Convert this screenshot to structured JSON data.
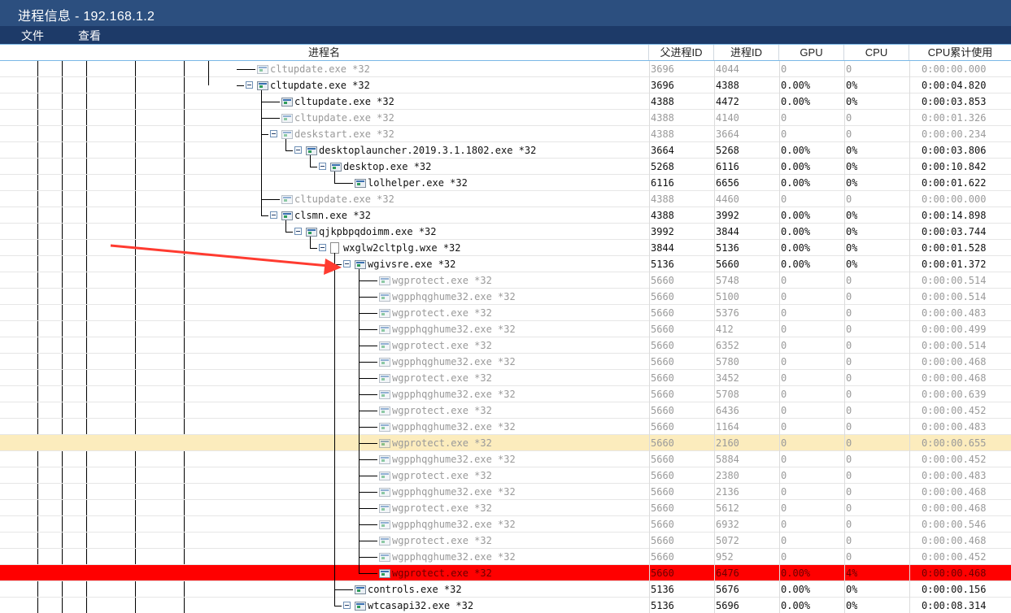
{
  "window": {
    "title": "进程信息 - 192.168.1.2"
  },
  "menu": [
    {
      "label": "文件"
    },
    {
      "label": "查看"
    }
  ],
  "columns": [
    {
      "key": "name",
      "label": "进程名"
    },
    {
      "key": "ppid",
      "label": "父进程ID"
    },
    {
      "key": "pid",
      "label": "进程ID"
    },
    {
      "key": "gpu",
      "label": "GPU"
    },
    {
      "key": "cpu",
      "label": "CPU"
    },
    {
      "key": "cputime",
      "label": "CPU累计使用"
    }
  ],
  "rows": [
    {
      "name": "cltupdate.exe *32",
      "ppid": "3696",
      "pid": "4044",
      "gpu": "0",
      "cpu": "0",
      "cputime": "0:00:00.000",
      "depth": 9,
      "expandable": false,
      "dim": true,
      "icon": "process-icon"
    },
    {
      "name": "cltupdate.exe *32",
      "ppid": "3696",
      "pid": "4388",
      "gpu": "0.00%",
      "cpu": "0%",
      "cputime": "0:00:04.820",
      "depth": 9,
      "expandable": true,
      "dim": false,
      "icon": "process-icon"
    },
    {
      "name": "cltupdate.exe *32",
      "ppid": "4388",
      "pid": "4472",
      "gpu": "0.00%",
      "cpu": "0%",
      "cputime": "0:00:03.853",
      "depth": 10,
      "expandable": false,
      "dim": false,
      "icon": "process-icon"
    },
    {
      "name": "cltupdate.exe *32",
      "ppid": "4388",
      "pid": "4140",
      "gpu": "0",
      "cpu": "0",
      "cputime": "0:00:01.326",
      "depth": 10,
      "expandable": false,
      "dim": true,
      "icon": "process-icon"
    },
    {
      "name": "deskstart.exe *32",
      "ppid": "4388",
      "pid": "3664",
      "gpu": "0",
      "cpu": "0",
      "cputime": "0:00:00.234",
      "depth": 10,
      "expandable": true,
      "dim": true,
      "icon": "process-icon"
    },
    {
      "name": "desktoplauncher.2019.3.1.1802.exe *32",
      "ppid": "3664",
      "pid": "5268",
      "gpu": "0.00%",
      "cpu": "0%",
      "cputime": "0:00:03.806",
      "depth": 11,
      "expandable": true,
      "dim": false,
      "icon": "process-icon"
    },
    {
      "name": "desktop.exe *32",
      "ppid": "5268",
      "pid": "6116",
      "gpu": "0.00%",
      "cpu": "0%",
      "cputime": "0:00:10.842",
      "depth": 12,
      "expandable": true,
      "dim": false,
      "icon": "process-icon"
    },
    {
      "name": "lolhelper.exe *32",
      "ppid": "6116",
      "pid": "6656",
      "gpu": "0.00%",
      "cpu": "0%",
      "cputime": "0:00:01.622",
      "depth": 13,
      "expandable": false,
      "dim": false,
      "icon": "process-icon"
    },
    {
      "name": "cltupdate.exe *32",
      "ppid": "4388",
      "pid": "4460",
      "gpu": "0",
      "cpu": "0",
      "cputime": "0:00:00.000",
      "depth": 10,
      "expandable": false,
      "dim": true,
      "icon": "process-icon"
    },
    {
      "name": "clsmn.exe *32",
      "ppid": "4388",
      "pid": "3992",
      "gpu": "0.00%",
      "cpu": "0%",
      "cputime": "0:00:14.898",
      "depth": 10,
      "expandable": true,
      "dim": false,
      "icon": "process-icon"
    },
    {
      "name": "qjkpbpqdoimm.exe *32",
      "ppid": "3992",
      "pid": "3844",
      "gpu": "0.00%",
      "cpu": "0%",
      "cputime": "0:00:03.744",
      "depth": 11,
      "expandable": true,
      "dim": false,
      "icon": "process-icon"
    },
    {
      "name": "wxglw2cltplg.wxe *32",
      "ppid": "3844",
      "pid": "5136",
      "gpu": "0.00%",
      "cpu": "0%",
      "cputime": "0:00:01.528",
      "depth": 12,
      "expandable": true,
      "dim": false,
      "icon": "document-icon"
    },
    {
      "name": "wgivsre.exe *32",
      "ppid": "5136",
      "pid": "5660",
      "gpu": "0.00%",
      "cpu": "0%",
      "cputime": "0:00:01.372",
      "depth": 13,
      "expandable": true,
      "dim": false,
      "icon": "process-icon"
    },
    {
      "name": "wgprotect.exe *32",
      "ppid": "5660",
      "pid": "5748",
      "gpu": "0",
      "cpu": "0",
      "cputime": "0:00:00.514",
      "depth": 14,
      "expandable": false,
      "dim": true,
      "icon": "process-icon"
    },
    {
      "name": "wgpphqghume32.exe *32",
      "ppid": "5660",
      "pid": "5100",
      "gpu": "0",
      "cpu": "0",
      "cputime": "0:00:00.514",
      "depth": 14,
      "expandable": false,
      "dim": true,
      "icon": "process-icon"
    },
    {
      "name": "wgprotect.exe *32",
      "ppid": "5660",
      "pid": "5376",
      "gpu": "0",
      "cpu": "0",
      "cputime": "0:00:00.483",
      "depth": 14,
      "expandable": false,
      "dim": true,
      "icon": "process-icon"
    },
    {
      "name": "wgpphqghume32.exe *32",
      "ppid": "5660",
      "pid": "412",
      "gpu": "0",
      "cpu": "0",
      "cputime": "0:00:00.499",
      "depth": 14,
      "expandable": false,
      "dim": true,
      "icon": "process-icon"
    },
    {
      "name": "wgprotect.exe *32",
      "ppid": "5660",
      "pid": "6352",
      "gpu": "0",
      "cpu": "0",
      "cputime": "0:00:00.514",
      "depth": 14,
      "expandable": false,
      "dim": true,
      "icon": "process-icon"
    },
    {
      "name": "wgpphqghume32.exe *32",
      "ppid": "5660",
      "pid": "5780",
      "gpu": "0",
      "cpu": "0",
      "cputime": "0:00:00.468",
      "depth": 14,
      "expandable": false,
      "dim": true,
      "icon": "process-icon"
    },
    {
      "name": "wgprotect.exe *32",
      "ppid": "5660",
      "pid": "3452",
      "gpu": "0",
      "cpu": "0",
      "cputime": "0:00:00.468",
      "depth": 14,
      "expandable": false,
      "dim": true,
      "icon": "process-icon"
    },
    {
      "name": "wgpphqghume32.exe *32",
      "ppid": "5660",
      "pid": "5708",
      "gpu": "0",
      "cpu": "0",
      "cputime": "0:00:00.639",
      "depth": 14,
      "expandable": false,
      "dim": true,
      "icon": "process-icon"
    },
    {
      "name": "wgprotect.exe *32",
      "ppid": "5660",
      "pid": "6436",
      "gpu": "0",
      "cpu": "0",
      "cputime": "0:00:00.452",
      "depth": 14,
      "expandable": false,
      "dim": true,
      "icon": "process-icon"
    },
    {
      "name": "wgpphqghume32.exe *32",
      "ppid": "5660",
      "pid": "1164",
      "gpu": "0",
      "cpu": "0",
      "cputime": "0:00:00.483",
      "depth": 14,
      "expandable": false,
      "dim": true,
      "icon": "process-icon"
    },
    {
      "name": "wgprotect.exe *32",
      "ppid": "5660",
      "pid": "2160",
      "gpu": "0",
      "cpu": "0",
      "cputime": "0:00:00.655",
      "depth": 14,
      "expandable": false,
      "dim": true,
      "icon": "process-icon",
      "highlight": "yellow"
    },
    {
      "name": "wgpphqghume32.exe *32",
      "ppid": "5660",
      "pid": "5884",
      "gpu": "0",
      "cpu": "0",
      "cputime": "0:00:00.452",
      "depth": 14,
      "expandable": false,
      "dim": true,
      "icon": "process-icon"
    },
    {
      "name": "wgprotect.exe *32",
      "ppid": "5660",
      "pid": "2380",
      "gpu": "0",
      "cpu": "0",
      "cputime": "0:00:00.483",
      "depth": 14,
      "expandable": false,
      "dim": true,
      "icon": "process-icon"
    },
    {
      "name": "wgpphqghume32.exe *32",
      "ppid": "5660",
      "pid": "2136",
      "gpu": "0",
      "cpu": "0",
      "cputime": "0:00:00.468",
      "depth": 14,
      "expandable": false,
      "dim": true,
      "icon": "process-icon"
    },
    {
      "name": "wgprotect.exe *32",
      "ppid": "5660",
      "pid": "5612",
      "gpu": "0",
      "cpu": "0",
      "cputime": "0:00:00.468",
      "depth": 14,
      "expandable": false,
      "dim": true,
      "icon": "process-icon"
    },
    {
      "name": "wgpphqghume32.exe *32",
      "ppid": "5660",
      "pid": "6932",
      "gpu": "0",
      "cpu": "0",
      "cputime": "0:00:00.546",
      "depth": 14,
      "expandable": false,
      "dim": true,
      "icon": "process-icon"
    },
    {
      "name": "wgprotect.exe *32",
      "ppid": "5660",
      "pid": "5072",
      "gpu": "0",
      "cpu": "0",
      "cputime": "0:00:00.468",
      "depth": 14,
      "expandable": false,
      "dim": true,
      "icon": "process-icon"
    },
    {
      "name": "wgpphqghume32.exe *32",
      "ppid": "5660",
      "pid": "952",
      "gpu": "0",
      "cpu": "0",
      "cputime": "0:00:00.452",
      "depth": 14,
      "expandable": false,
      "dim": true,
      "icon": "process-icon"
    },
    {
      "name": "wgprotect.exe *32",
      "ppid": "5660",
      "pid": "6476",
      "gpu": "0.00%",
      "cpu": "4%",
      "cputime": "0:00:00.468",
      "depth": 14,
      "expandable": false,
      "dim": false,
      "icon": "process-icon",
      "highlight": "red"
    },
    {
      "name": "controls.exe *32",
      "ppid": "5136",
      "pid": "5676",
      "gpu": "0.00%",
      "cpu": "0%",
      "cputime": "0:00:00.156",
      "depth": 13,
      "expandable": false,
      "dim": false,
      "icon": "process-icon"
    },
    {
      "name": "wtcasapi32.exe *32",
      "ppid": "5136",
      "pid": "5696",
      "gpu": "0.00%",
      "cpu": "0%",
      "cputime": "0:00:08.314",
      "depth": 13,
      "expandable": true,
      "dim": false,
      "icon": "process-icon"
    }
  ],
  "annotation": {
    "arrow_color": "#ff3b30"
  }
}
